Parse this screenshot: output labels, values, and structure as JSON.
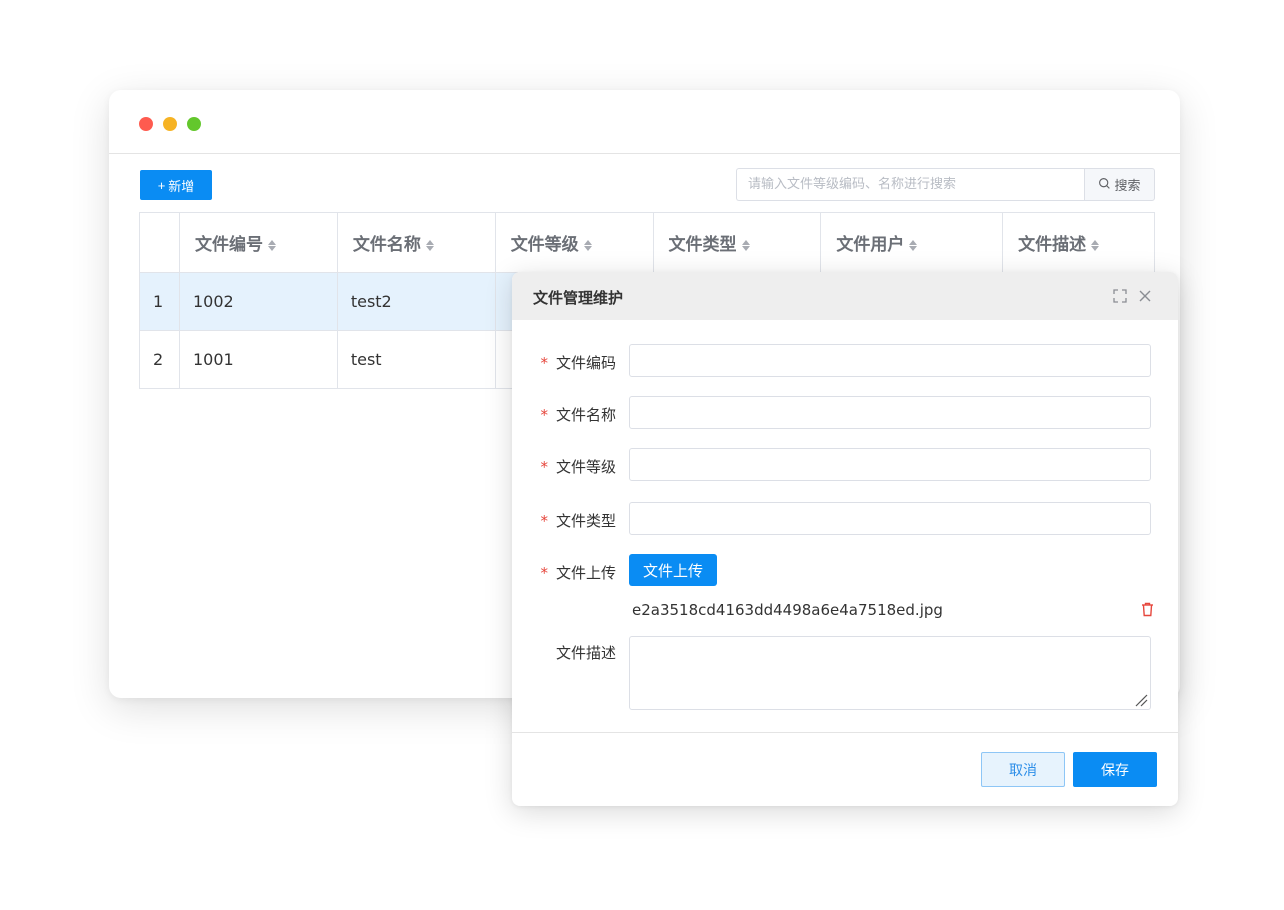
{
  "toolbar": {
    "add_label": "新增",
    "add_icon": "plus-icon",
    "search_placeholder": "请输入文件等级编码、名称进行搜索",
    "search_label": "搜索",
    "search_icon": "search-icon"
  },
  "table": {
    "headers": [
      "文件编号",
      "文件名称",
      "文件等级",
      "文件类型",
      "文件用户",
      "文件描述"
    ],
    "rows": [
      {
        "index": "1",
        "code": "1002",
        "name": "test2",
        "selected": true
      },
      {
        "index": "2",
        "code": "1001",
        "name": "test",
        "selected": false
      }
    ]
  },
  "dialog": {
    "title": "文件管理维护",
    "fields": {
      "code_label": "文件编码",
      "name_label": "文件名称",
      "level_label": "文件等级",
      "type_label": "文件类型",
      "upload_label": "文件上传",
      "desc_label": "文件描述"
    },
    "required_mark": "*",
    "upload_button": "文件上传",
    "uploaded_file": "e2a3518cd4163dd4498a6e4a7518ed.jpg",
    "cancel_label": "取消",
    "save_label": "保存"
  },
  "colors": {
    "primary": "#0a8cf3",
    "selected_row": "#e5f2fd",
    "required": "#e6463c",
    "dot_red": "#fe5b4f",
    "dot_yellow": "#f6b324",
    "dot_green": "#63c72c"
  }
}
